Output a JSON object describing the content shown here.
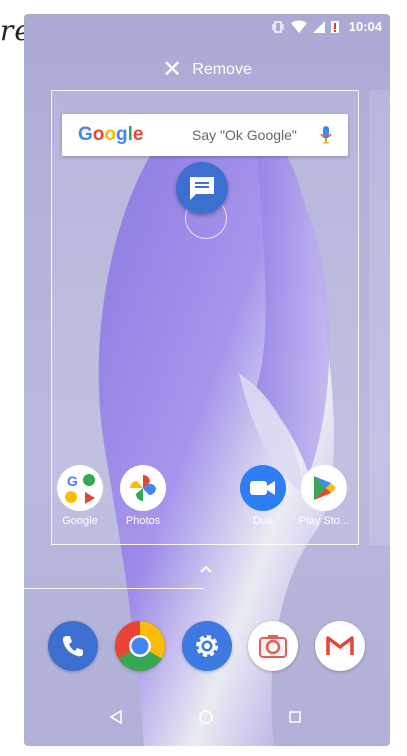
{
  "overflow_text": "re",
  "status": {
    "time": "10:04"
  },
  "remove": {
    "label": "Remove"
  },
  "search": {
    "logo": "Google",
    "hint": "Say \"Ok Google\""
  },
  "apps": [
    {
      "label": "Google",
      "icon": "google-folder-icon"
    },
    {
      "label": "Photos",
      "icon": "photos-icon"
    },
    {
      "label": "Duo",
      "icon": "duo-icon"
    },
    {
      "label": "Play Sto...",
      "icon": "play-store-icon"
    }
  ],
  "dock": [
    {
      "name": "phone-icon"
    },
    {
      "name": "chrome-icon"
    },
    {
      "name": "settings-icon"
    },
    {
      "name": "camera-icon"
    },
    {
      "name": "gmail-icon"
    }
  ],
  "colors": {
    "google_blue": "#4285F4",
    "google_red": "#EA4335",
    "google_yellow": "#FBBC05",
    "google_green": "#34A853"
  }
}
